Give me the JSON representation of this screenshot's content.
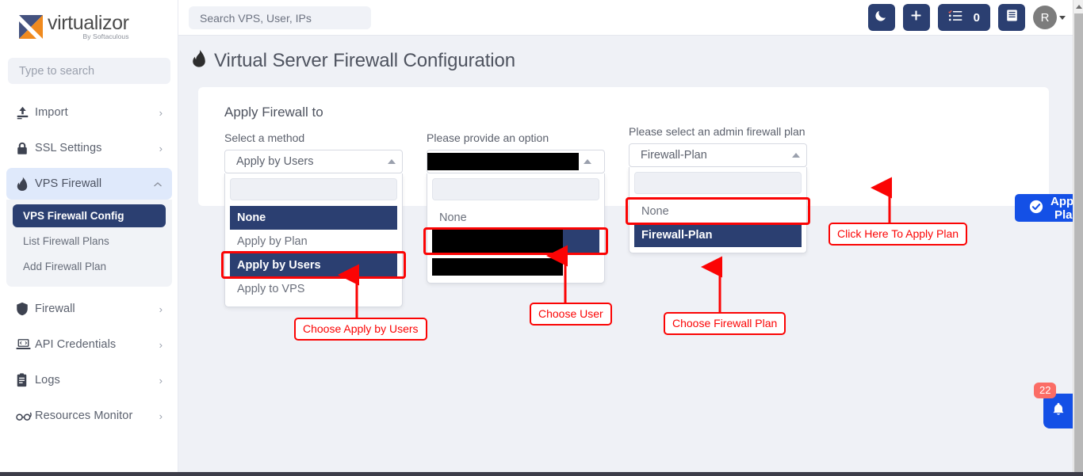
{
  "brand": {
    "name": "virtualizor",
    "tagline": "By Softaculous"
  },
  "sidebar": {
    "search_placeholder": "Type to search",
    "items": [
      {
        "label": "Import",
        "icon": "upload-icon",
        "chevron": "›"
      },
      {
        "label": "SSL Settings",
        "icon": "lock-icon",
        "chevron": "›"
      },
      {
        "label": "VPS Firewall",
        "icon": "flame-icon",
        "chevron": "˄",
        "active": true
      },
      {
        "label": "Firewall",
        "icon": "shield-icon",
        "chevron": "›"
      },
      {
        "label": "API Credentials",
        "icon": "laptop-code-icon",
        "chevron": "›"
      },
      {
        "label": "Logs",
        "icon": "clipboard-icon",
        "chevron": "›"
      },
      {
        "label": "Resources Monitor",
        "icon": "glasses-icon",
        "chevron": "›"
      }
    ],
    "subitems": [
      {
        "label": "VPS Firewall Config",
        "selected": true
      },
      {
        "label": "List Firewall Plans",
        "selected": false
      },
      {
        "label": "Add Firewall Plan",
        "selected": false
      }
    ]
  },
  "topbar": {
    "search_placeholder": "Search VPS, User, IPs",
    "dark_mode_icon": "moon-icon",
    "add_icon": "plus-icon",
    "tasks_icon": "task-list-icon",
    "tasks_count": "0",
    "docs_icon": "book-icon",
    "avatar_initial": "R",
    "avatar_caret_icon": "caret-down-icon"
  },
  "page": {
    "title": "Virtual Server Firewall Configuration",
    "title_icon": "flame-icon"
  },
  "card": {
    "heading": "Apply Firewall to",
    "method": {
      "label": "Select a method",
      "value": "Apply by Users",
      "caret_icon": "caret-up-icon",
      "search_value": "",
      "options": [
        {
          "label": "None",
          "state": "highlight"
        },
        {
          "label": "Apply by Plan",
          "state": "normal"
        },
        {
          "label": "Apply by Users",
          "state": "selected"
        },
        {
          "label": "Apply to VPS",
          "state": "normal"
        }
      ]
    },
    "option": {
      "label": "Please provide an option",
      "value": "",
      "value_redacted": true,
      "caret_icon": "caret-up-icon",
      "search_value": "",
      "options": [
        {
          "label": "None",
          "state": "normal"
        },
        {
          "label": "",
          "state": "selected",
          "redacted": true
        },
        {
          "label": "",
          "state": "normal",
          "redacted": true
        }
      ]
    },
    "plan": {
      "label": "Please select an admin firewall plan",
      "value": "Firewall-Plan",
      "caret_icon": "caret-up-icon",
      "search_value": "",
      "options": [
        {
          "label": "None",
          "state": "normal"
        },
        {
          "label": "Firewall-Plan",
          "state": "selected"
        }
      ]
    },
    "apply_button": {
      "label": "Apply Plan",
      "icon": "check-circle-icon",
      "color": "#1450e6"
    }
  },
  "annotations": [
    {
      "text": "Choose Apply by Users"
    },
    {
      "text": "Choose User"
    },
    {
      "text": "Choose Firewall Plan"
    },
    {
      "text": "Click Here To Apply Plan"
    }
  ],
  "notification": {
    "count": "22",
    "icon": "bell-icon"
  },
  "colors": {
    "accent_navy": "#2b3f71",
    "accent_blue": "#1450e6",
    "annotation_red": "#fb0404",
    "content_bg": "#eff1f6"
  }
}
